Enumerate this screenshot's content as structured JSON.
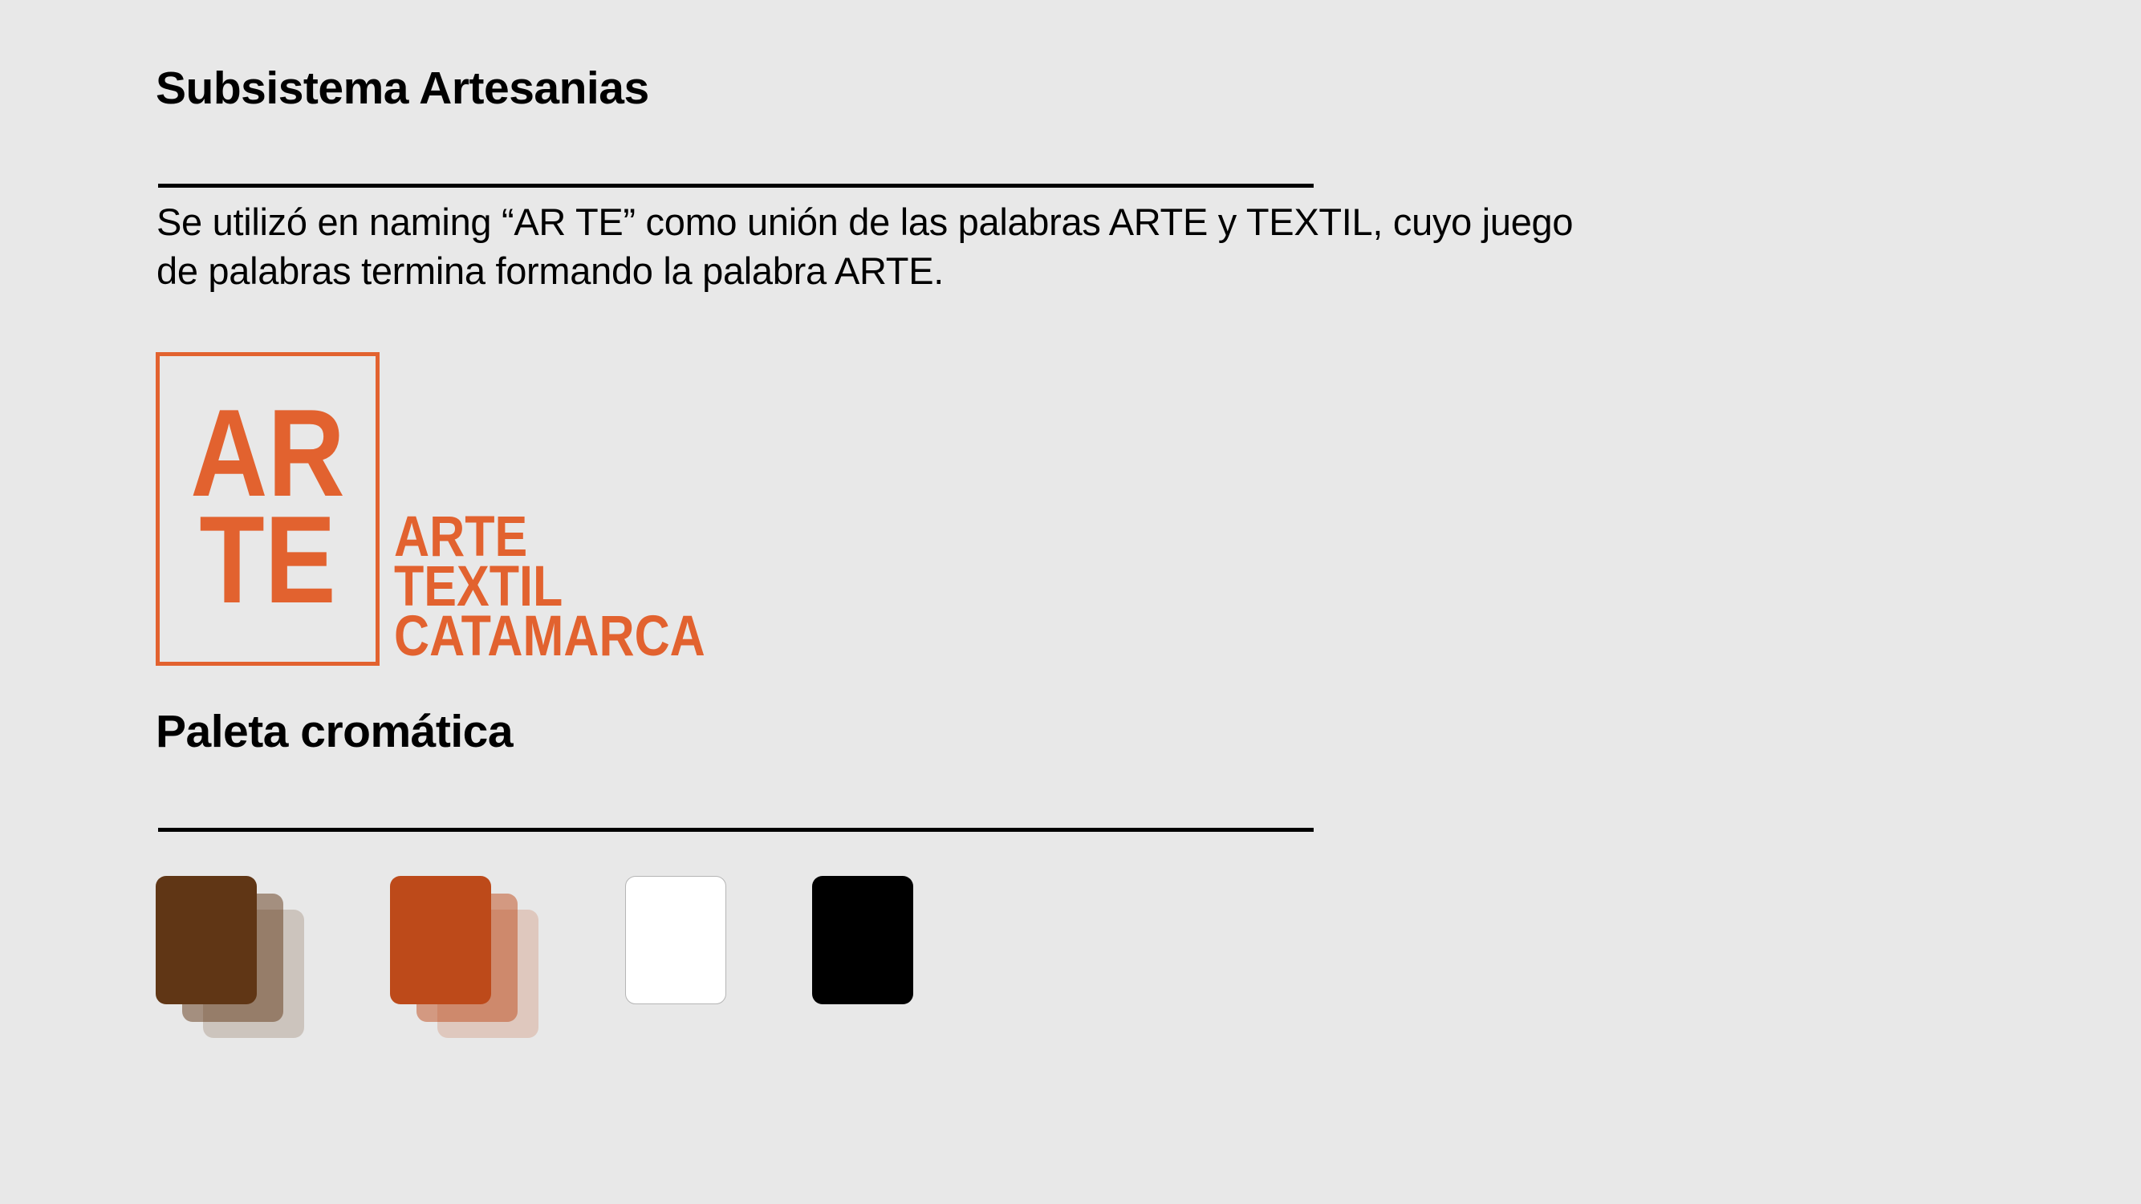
{
  "header": {
    "title": "Subsistema Artesanias"
  },
  "description": {
    "line1": "Se utilizó en naming “AR TE” como unión de las palabras ARTE y TEXTIL, cuyo juego",
    "line2": "de palabras termina formando la palabra ARTE."
  },
  "logo": {
    "mark_top": "AR",
    "mark_bottom": "TE",
    "word1": "ARTE",
    "word2": "TEXTIL",
    "word3": "CATAMARCA",
    "color": "#e2622f"
  },
  "palette": {
    "title": "Paleta cromática",
    "swatches": [
      {
        "color": "#603615",
        "tints": true
      },
      {
        "color": "#bd4a1a",
        "tints": true
      },
      {
        "color": "#ffffff",
        "tints": false
      },
      {
        "color": "#000000",
        "tints": false
      }
    ]
  }
}
